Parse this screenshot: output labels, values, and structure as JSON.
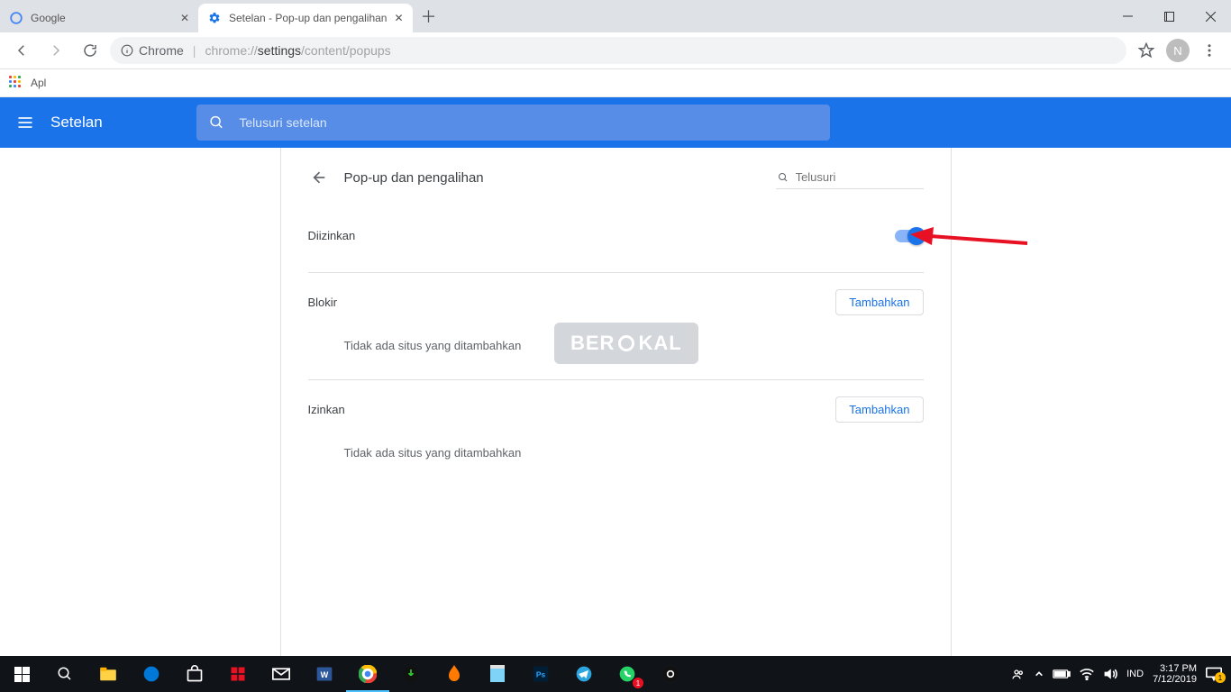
{
  "window": {
    "tabs": [
      {
        "title": "Google"
      },
      {
        "title": "Setelan - Pop-up dan pengalihan"
      }
    ]
  },
  "addressbar": {
    "origin_label": "Chrome",
    "url_dim_prefix": "chrome://",
    "url_dark": "settings",
    "url_dim_suffix": "/content/popups"
  },
  "bookmarks": {
    "apps_label": "Apl"
  },
  "avatar": {
    "letter": "N"
  },
  "settings": {
    "header_title": "Setelan",
    "search_placeholder": "Telusuri setelan",
    "page_title": "Pop-up dan pengalihan",
    "detail_search_placeholder": "Telusuri",
    "allowed_label": "Diizinkan",
    "block_label": "Blokir",
    "allow_label": "Izinkan",
    "add_button": "Tambahkan",
    "empty_block": "Tidak ada situs yang ditambahkan",
    "empty_allow": "Tidak ada situs yang ditambahkan"
  },
  "watermark": {
    "prefix": "BER",
    "suffix": "KAL"
  },
  "taskbar": {
    "lang": "IND",
    "time": "3:17 PM",
    "date": "7/12/2019",
    "badge_whatsapp": "1",
    "badge_action_center": "1"
  }
}
